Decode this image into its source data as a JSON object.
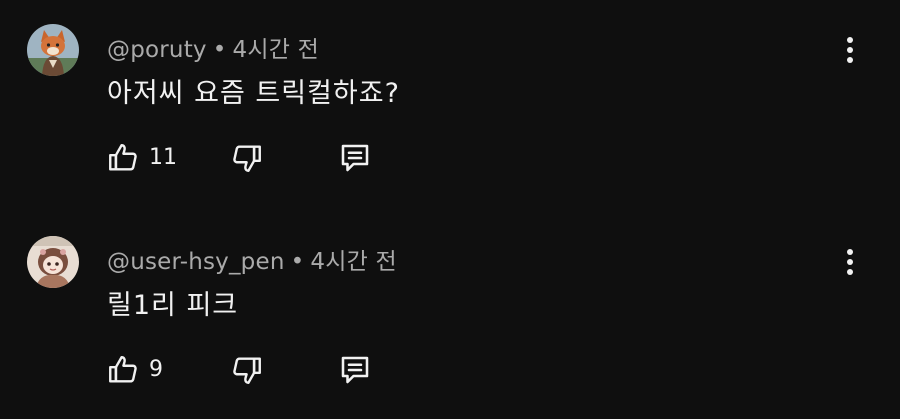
{
  "comments": [
    {
      "handle": "@poruty",
      "separator": "•",
      "time": "4시간 전",
      "text": "아저씨 요즘 트릭컬하죠?",
      "likes": "11",
      "avatar_icon": "fox-avatar-icon"
    },
    {
      "handle": "@user-hsy_pen",
      "separator": "•",
      "time": "4시간 전",
      "text": "릴1리 피크",
      "likes": "9",
      "avatar_icon": "character-avatar-icon"
    }
  ],
  "icons": {
    "like": "thumbs-up-icon",
    "dislike": "thumbs-down-icon",
    "reply": "reply-comment-icon",
    "more": "more-vertical-icon"
  },
  "colors": {
    "background": "#0f0f0f",
    "text": "#f1f1f1",
    "meta": "#aaaaaa"
  }
}
